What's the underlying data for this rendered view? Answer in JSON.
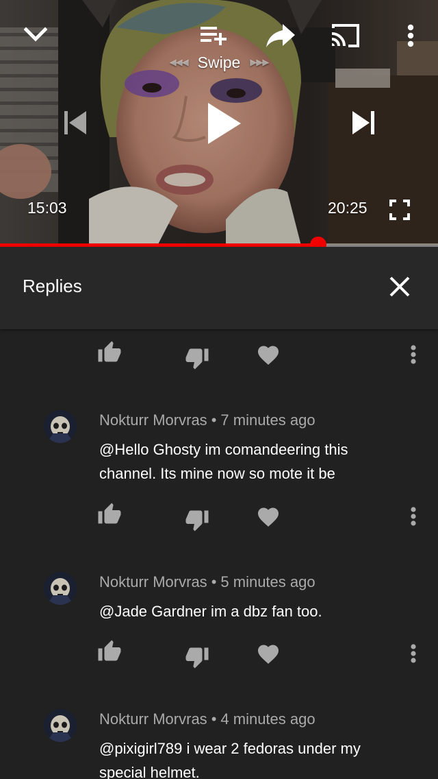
{
  "player": {
    "swipe_label": "Swipe",
    "swipe_left_arrows": "◀◀◀",
    "swipe_right_arrows": "▶▶▶",
    "current_time": "15:03",
    "duration": "20:25",
    "progress_fraction": 0.727,
    "accent_color": "#f00000"
  },
  "icons": {
    "collapse": "chevron-down-icon",
    "add_to_queue": "playlist-add-icon",
    "share": "share-icon",
    "cast": "cast-icon",
    "more": "more-vertical-icon",
    "previous": "skip-previous-icon",
    "play": "play-icon",
    "next": "skip-next-icon",
    "fullscreen": "fullscreen-icon",
    "close": "close-icon",
    "like": "thumb-up-icon",
    "dislike": "thumb-down-icon",
    "heart": "heart-icon"
  },
  "replies": {
    "title": "Replies",
    "comments": [
      {
        "author": "Nokturr Morvras",
        "separator": "•",
        "time": "7 minutes ago",
        "text": "@Hello Ghosty im comandeering this channel. Its mine now so mote it be"
      },
      {
        "author": "Nokturr Morvras",
        "separator": "•",
        "time": "5 minutes ago",
        "text": "@Jade Gardner im a dbz fan too."
      },
      {
        "author": "Nokturr Morvras",
        "separator": "•",
        "time": "4 minutes ago",
        "text": "@pixigirl789 i wear 2 fedoras under my special helmet."
      }
    ]
  }
}
